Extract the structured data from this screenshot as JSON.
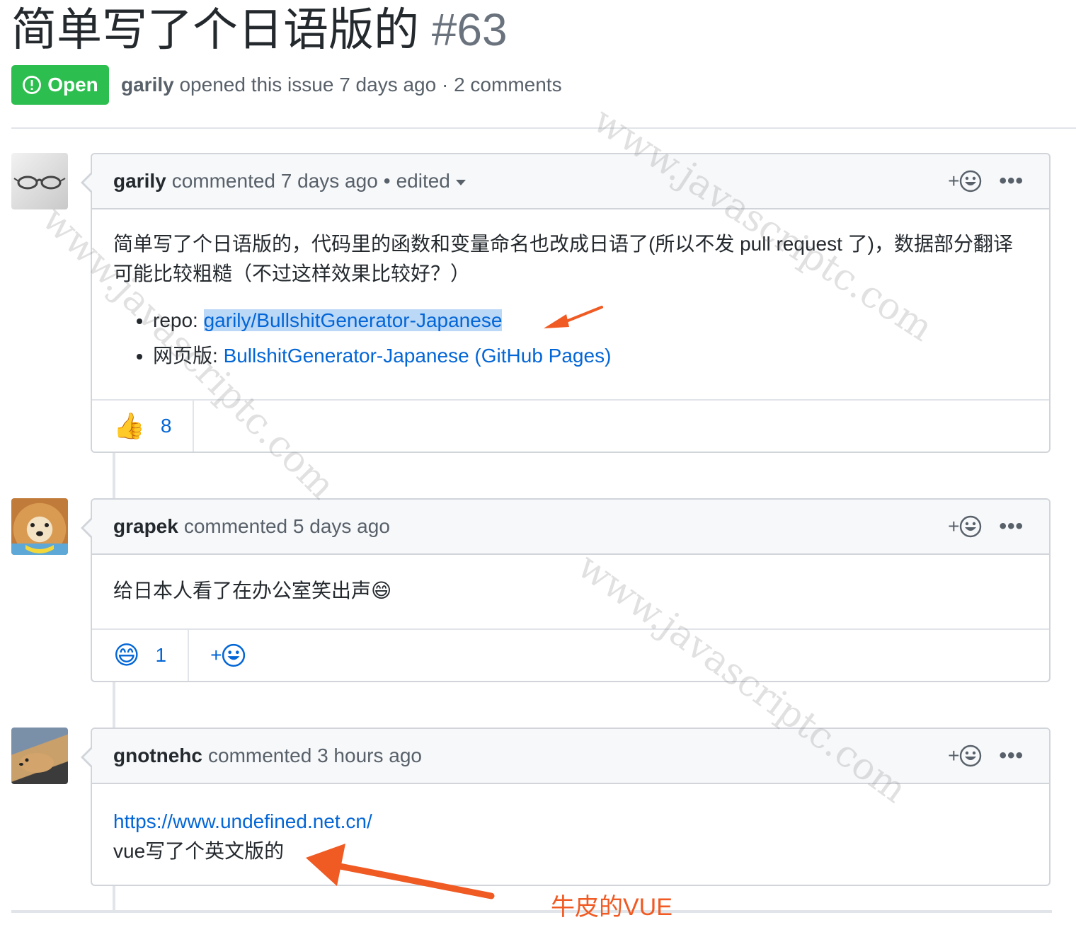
{
  "issue": {
    "title": "简单写了个日语版的",
    "number": "#63",
    "state": "Open",
    "author": "garily",
    "meta_text": "opened this issue 7 days ago · 2 comments"
  },
  "comments": [
    {
      "author": "garily",
      "action": "commented 7 days ago",
      "edited": "edited",
      "body_text": "简单写了个日语版的，代码里的函数和变量命名也改成日语了(所以不发 pull request 了)，数据部分翻译可能比较粗糙（不过这样效果比较好？）",
      "list": [
        {
          "label": "repo: ",
          "link": "garily/BullshitGenerator-Japanese"
        },
        {
          "label": "网页版: ",
          "link": "BullshitGenerator-Japanese (GitHub Pages)"
        }
      ],
      "reactions": [
        {
          "emoji": "👍",
          "count": "8"
        }
      ]
    },
    {
      "author": "grapek",
      "action": "commented 5 days ago",
      "body_text": "给日本人看了在办公室笑出声😄",
      "reactions": [
        {
          "emoji": "😄",
          "count": "1"
        }
      ],
      "add_reaction": "+"
    },
    {
      "author": "gnotnehc",
      "action": "commented 3 hours ago",
      "link": "https://www.undefined.net.cn/",
      "body_text": "vue写了个英文版的"
    }
  ],
  "annotation": "牛皮的VUE",
  "watermark": "www.javascriptc.com",
  "colors": {
    "open_green": "#2cbe4e",
    "link_blue": "#0366d6",
    "annotation_orange": "#f05a23"
  }
}
